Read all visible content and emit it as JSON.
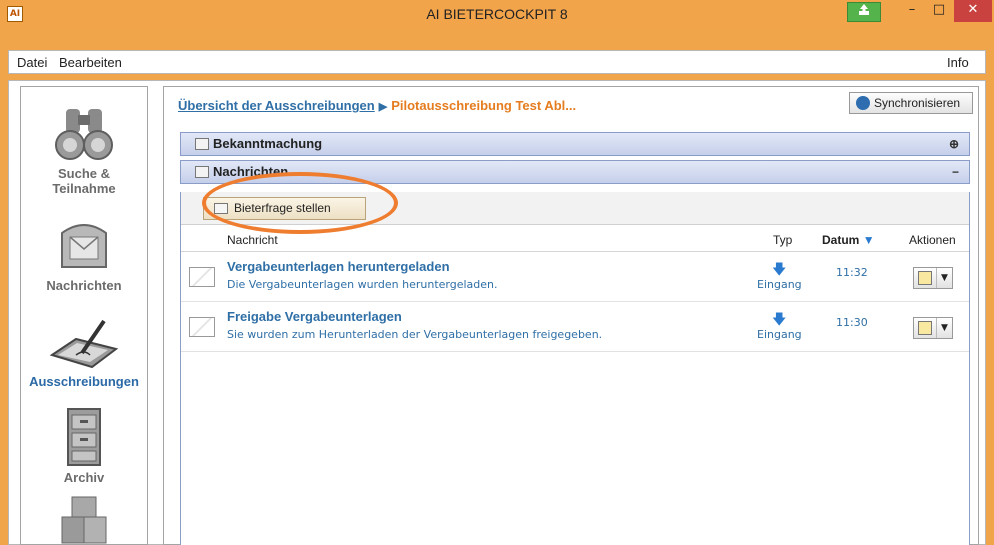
{
  "window": {
    "title": "AI BIETERCOCKPIT 8",
    "app_icon_text": "AI"
  },
  "menu": {
    "datei": "Datei",
    "bearbeiten": "Bearbeiten",
    "info": "Info"
  },
  "sidebar": {
    "items": [
      {
        "label_line1": "Suche &",
        "label_line2": "Teilnahme",
        "icon": "binoculars-icon"
      },
      {
        "label_line1": "Nachrichten",
        "label_line2": "",
        "icon": "mailbox-icon"
      },
      {
        "label_line1": "Ausschreibungen",
        "label_line2": "",
        "icon": "signing-tablet-icon",
        "active": true
      },
      {
        "label_line1": "Archiv",
        "label_line2": "",
        "icon": "filing-cabinet-icon"
      },
      {
        "label_line1": "",
        "label_line2": "",
        "icon": "boxes-icon"
      }
    ]
  },
  "breadcrumb": {
    "link": "Übersicht der Ausschreibungen",
    "current": "Pilotausschreibung Test Abl..."
  },
  "sync_button": {
    "label": "Synchronisieren"
  },
  "panels": {
    "bekanntmachung": {
      "title": "Bekanntmachung",
      "toggle": "⊕"
    },
    "nachrichten": {
      "title": "Nachrichten",
      "toggle": "−"
    }
  },
  "toolbar": {
    "ask_label": "Bieterfrage stellen"
  },
  "table": {
    "headers": {
      "nachricht": "Nachricht",
      "typ": "Typ",
      "datum": "Datum",
      "aktionen": "Aktionen"
    },
    "rows": [
      {
        "title": "Vergabeunterlagen heruntergeladen",
        "subtitle": "Die Vergabeunterlagen wurden heruntergeladen.",
        "type": "Eingang",
        "time": "11:32"
      },
      {
        "title": "Freigabe Vergabeunterlagen",
        "subtitle": "Sie wurden zum Herunterladen der Vergabeunterlagen freigegeben.",
        "type": "Eingang",
        "time": "11:30"
      }
    ]
  },
  "colors": {
    "titlebar": "#f2a44b",
    "accent_blue": "#2f6fa6",
    "accent_orange": "#e57c1f",
    "highlight_ring": "#ef7d2f",
    "close_button": "#c9423f"
  }
}
